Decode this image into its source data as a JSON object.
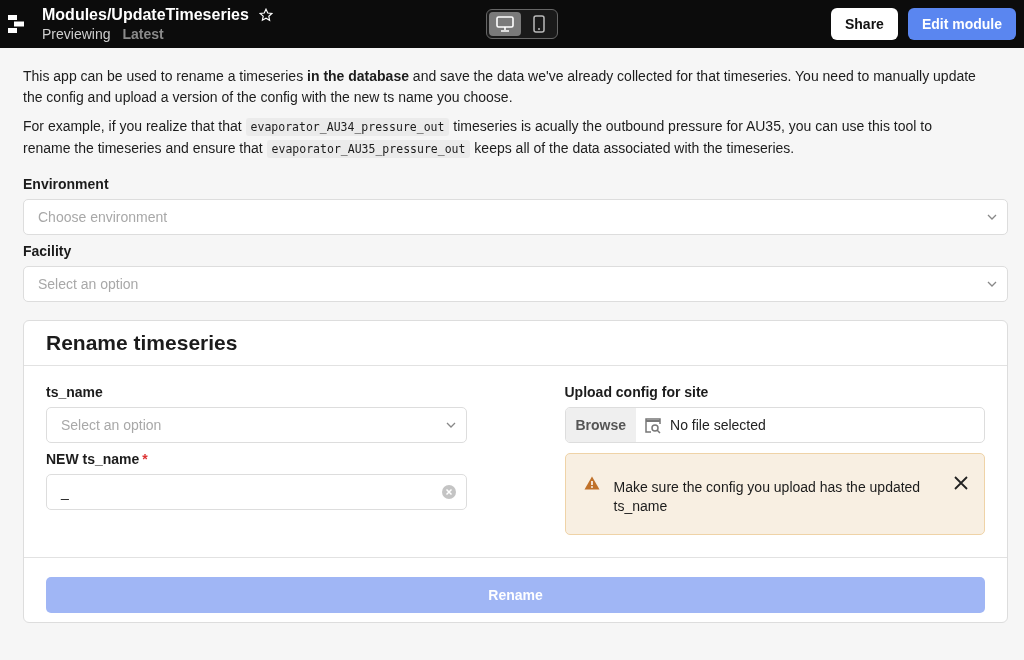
{
  "header": {
    "title": "Modules/UpdateTimeseries",
    "starred": false,
    "mode": "Previewing",
    "version": "Latest",
    "view_toggle": [
      {
        "kind": "desktop",
        "selected": true
      },
      {
        "kind": "mobile",
        "selected": false
      }
    ],
    "buttons": [
      {
        "kind": "secondary",
        "label": "Share"
      },
      {
        "kind": "primary",
        "label": "Edit module"
      }
    ]
  },
  "intro": [
    [
      {
        "kind": "text",
        "text": "This app can be used to rename a timeseries **in the database** and save the data we've already collected for that timeseries. You need to manually update the config and upload a version of the config with the new ts name you choose."
      }
    ],
    [
      {
        "kind": "text",
        "text": "For example, if you realize that that "
      },
      {
        "kind": "code",
        "text": "evaporator_AU34_pressure_out"
      },
      {
        "kind": "text",
        "text": " timeseries is acually the outbound pressure for AU35, you can use this tool to rename the timeseries and ensure that "
      },
      {
        "kind": "code",
        "text": "evaporator_AU35_pressure_out"
      },
      {
        "kind": "text",
        "text": " keeps all of the data associated with the timeseries."
      }
    ]
  ],
  "fields": [
    {
      "label": "Environment",
      "placeholder": "Choose environment"
    },
    {
      "label": "Facility",
      "placeholder": "Select an option"
    }
  ],
  "card": {
    "title": "Rename timeseries",
    "left": [
      {
        "kind": "select",
        "label": "ts_name",
        "placeholder": "Select an option"
      },
      {
        "kind": "text",
        "label": "NEW ts_name",
        "required_mark": "*",
        "value": "_"
      }
    ],
    "upload": {
      "label": "Upload config for site",
      "button": "Browse",
      "status": "No file selected"
    },
    "alert": {
      "text": "Make sure the config you upload has the updated ts_name"
    },
    "submit": {
      "label": "Rename",
      "disabled": true
    }
  }
}
